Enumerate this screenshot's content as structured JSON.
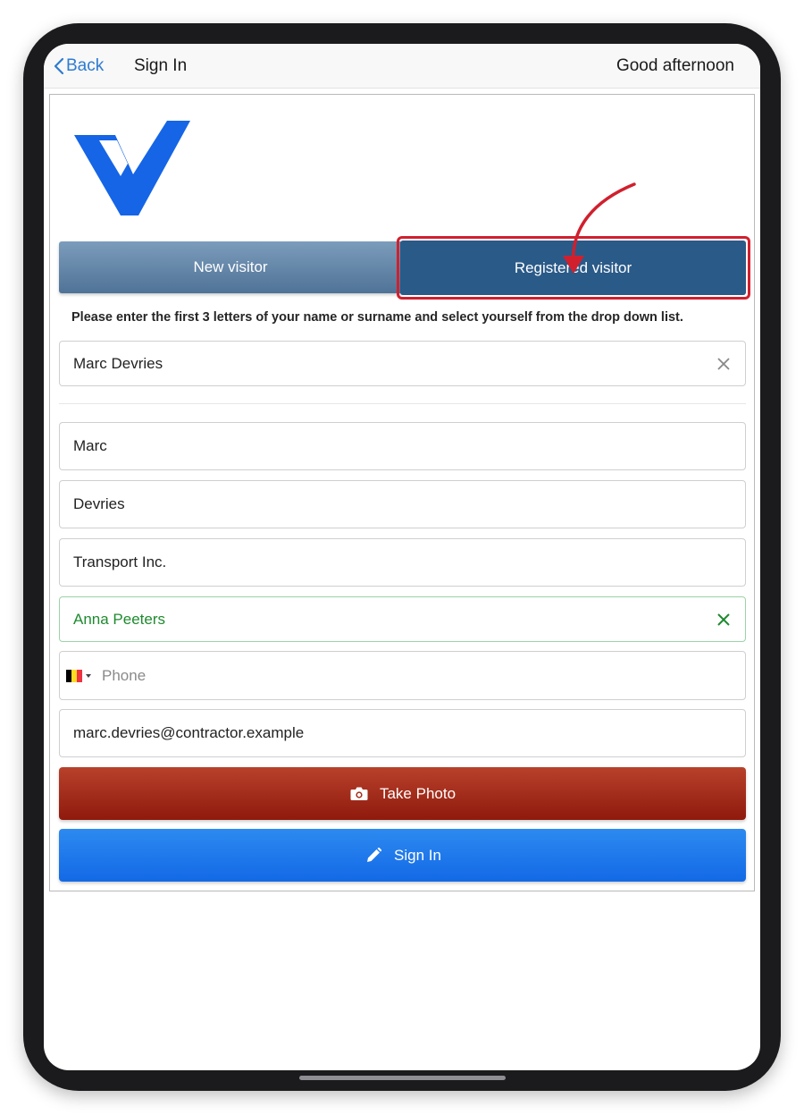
{
  "navbar": {
    "back_label": "Back",
    "title": "Sign In",
    "greeting": "Good afternoon"
  },
  "logo": {
    "icon": "v-checkmark-logo",
    "color": "#1565e6"
  },
  "tabs": [
    {
      "label": "New visitor",
      "active": false
    },
    {
      "label": "Registered visitor",
      "active": true
    }
  ],
  "annotation": {
    "color": "#d0202e",
    "target": "Registered visitor"
  },
  "instructions": "Please enter the first 3 letters of your name or surname and select yourself from the drop down list.",
  "search": {
    "value": "Marc Devries",
    "clear_icon": "close-icon"
  },
  "form": {
    "first_name": "Marc",
    "last_name": "Devries",
    "company": "Transport Inc.",
    "host": "Anna Peeters",
    "host_icon": "check-icon",
    "phone": {
      "country": "BE",
      "flag_colors": [
        "#000000",
        "#fdda24",
        "#ef3340"
      ],
      "placeholder": "Phone",
      "value": ""
    },
    "email": "marc.devries@contractor.example"
  },
  "buttons": {
    "take_photo": {
      "label": "Take Photo",
      "icon": "camera-icon",
      "color": "#a52b1a"
    },
    "sign_in": {
      "label": "Sign In",
      "icon": "pencil-icon",
      "color": "#1f7aee"
    }
  }
}
